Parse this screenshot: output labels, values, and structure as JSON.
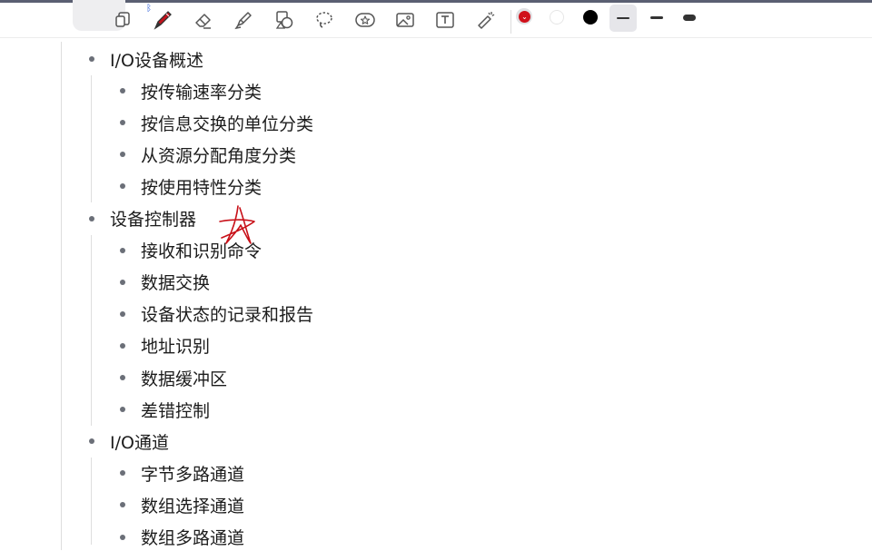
{
  "toolbar": {
    "tools": [
      {
        "icon": "page-layout-icon"
      },
      {
        "icon": "pen-icon"
      },
      {
        "icon": "eraser-icon"
      },
      {
        "icon": "highlighter-icon"
      },
      {
        "icon": "shapes-icon"
      },
      {
        "icon": "lasso-icon"
      },
      {
        "icon": "sticker-icon"
      },
      {
        "icon": "image-icon"
      },
      {
        "icon": "text-box-icon"
      },
      {
        "icon": "laser-pointer-icon"
      }
    ],
    "bluetooth_icon": "bluetooth-icon",
    "colors": [
      {
        "name": "red",
        "hex": "#d0101a",
        "selected": true
      },
      {
        "name": "white",
        "hex": "#ffffff",
        "selected": false
      },
      {
        "name": "black",
        "hex": "#000000",
        "selected": false
      }
    ],
    "stroke_widths": [
      "thin",
      "medium",
      "thick"
    ],
    "selected_stroke": "thin"
  },
  "outline": {
    "sections": [
      {
        "title": "I/O设备概述",
        "items": [
          "按传输速率分类",
          "按信息交换的单位分类",
          "从资源分配角度分类",
          "按使用特性分类"
        ]
      },
      {
        "title": "设备控制器",
        "items": [
          "接收和识别命令",
          "数据交换",
          "设备状态的记录和报告",
          "地址识别",
          "数据缓冲区",
          "差错控制"
        ]
      },
      {
        "title": "I/O通道",
        "items": [
          "字节多路通道",
          "数组选择通道",
          "数组多路通道"
        ]
      }
    ]
  },
  "annotation": {
    "shape": "hand-drawn-star",
    "color": "#d0101a"
  }
}
